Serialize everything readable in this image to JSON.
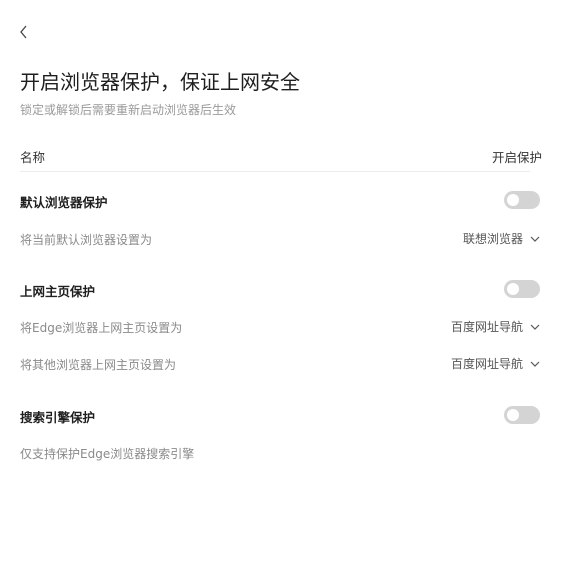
{
  "header": {
    "title": "开启浏览器保护，保证上网安全",
    "subtitle": "锁定或解锁后需要重新启动浏览器后生效"
  },
  "columns": {
    "name": "名称",
    "status": "开启保护"
  },
  "sections": [
    {
      "title": "默认浏览器保护",
      "enabled": false,
      "rows": [
        {
          "label": "将当前默认浏览器设置为",
          "value": "联想浏览器"
        }
      ]
    },
    {
      "title": "上网主页保护",
      "enabled": false,
      "rows": [
        {
          "label": "将Edge浏览器上网主页设置为",
          "value": "百度网址导航"
        },
        {
          "label": "将其他浏览器上网主页设置为",
          "value": "百度网址导航"
        }
      ]
    },
    {
      "title": "搜索引擎保护",
      "enabled": false,
      "rows": [
        {
          "label": "仅支持保护Edge浏览器搜索引擎"
        }
      ]
    }
  ],
  "icons": {
    "back": "chevron-left-icon",
    "dropdown": "chevron-down-icon"
  },
  "colors": {
    "toggle_off": "#d4d4d4",
    "divider": "#ececec",
    "muted_text": "#8a8a8a"
  }
}
